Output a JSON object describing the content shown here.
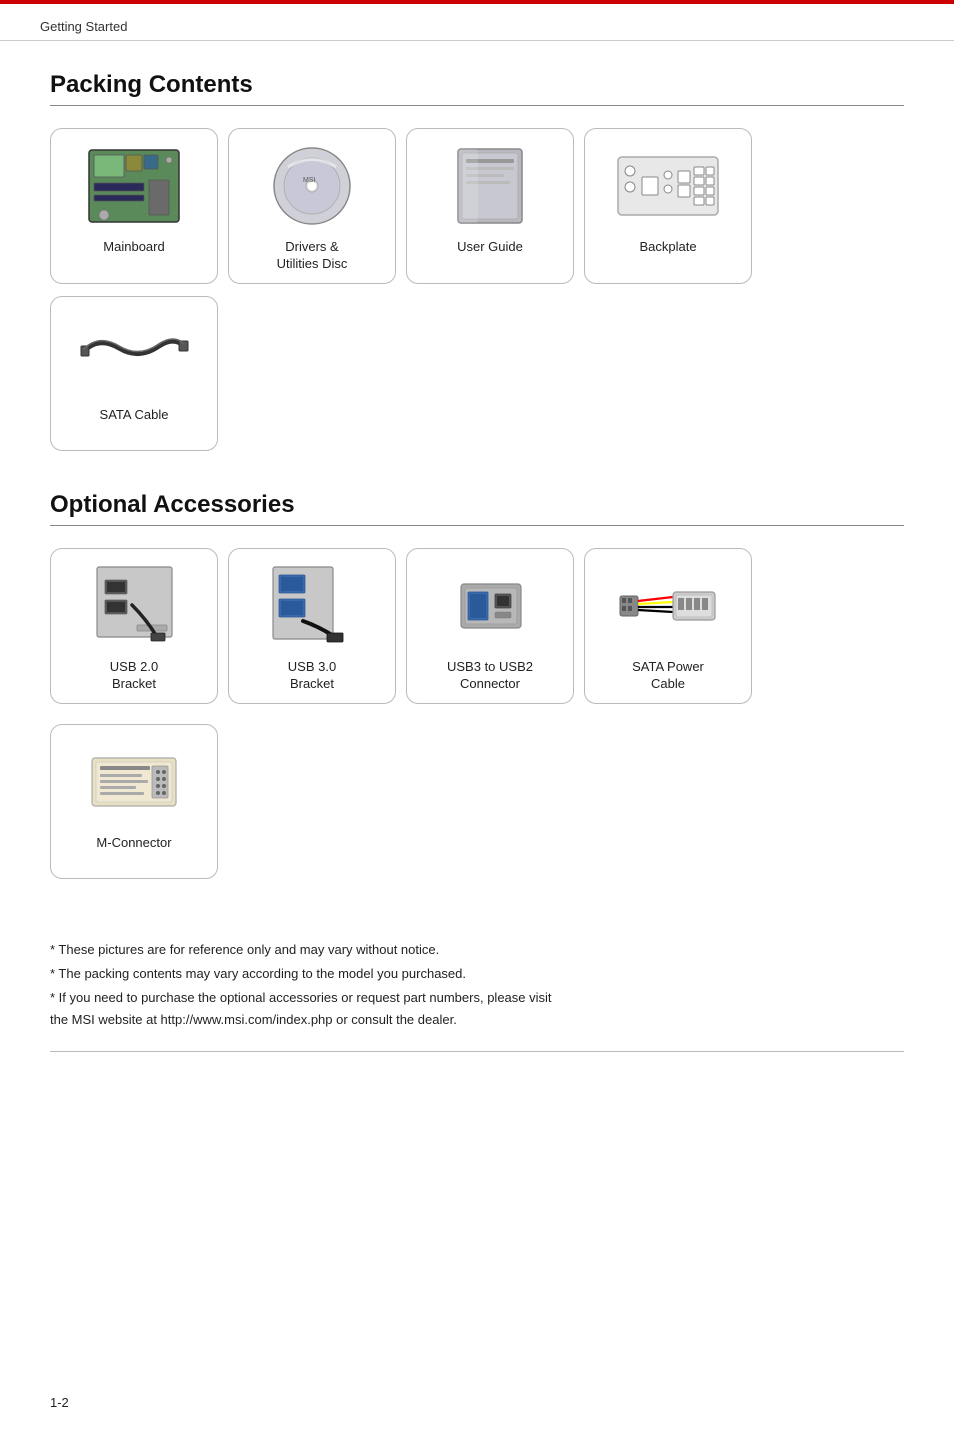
{
  "header": {
    "label": "Getting Started"
  },
  "packing": {
    "title": "Packing Contents",
    "items": [
      {
        "id": "mainboard",
        "label": "Mainboard"
      },
      {
        "id": "drivers-disc",
        "label": "Drivers &\nUtilities Disc"
      },
      {
        "id": "user-guide",
        "label": "User Guide"
      },
      {
        "id": "backplate",
        "label": "Backplate"
      },
      {
        "id": "sata-cable",
        "label": "SATA Cable"
      }
    ]
  },
  "optional": {
    "title": "Optional Accessories",
    "items": [
      {
        "id": "usb20-bracket",
        "label": "USB 2.0\nBracket"
      },
      {
        "id": "usb30-bracket",
        "label": "USB 3.0\nBracket"
      },
      {
        "id": "usb3-usb2-connector",
        "label": "USB3 to USB2\nConnector"
      },
      {
        "id": "sata-power-cable",
        "label": "SATA Power\nCable"
      },
      {
        "id": "m-connector",
        "label": "M-Connector"
      }
    ]
  },
  "notes": [
    "* These pictures are for reference only and may vary without notice.",
    "* The packing contents may vary according to the model you purchased.",
    "* If you need to purchase the optional accessories or request part numbers, please visit\nthe MSI website at http://www.msi.com/index.php or consult the dealer."
  ],
  "footer": {
    "page": "1-2"
  }
}
